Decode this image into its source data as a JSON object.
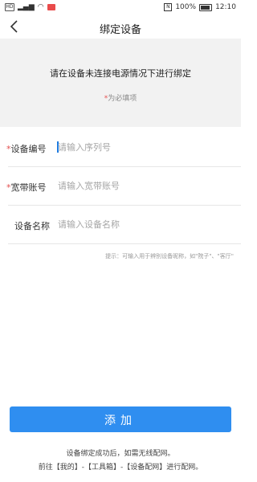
{
  "status_bar": {
    "battery_text": "100%",
    "time": "12:10",
    "nfc_label": "N"
  },
  "header": {
    "title": "绑定设备"
  },
  "banner": {
    "notice": "请在设备未连接电源情况下进行绑定",
    "required_star": "*",
    "required_text": "为必填项"
  },
  "form": {
    "device_id": {
      "star": "*",
      "label": "设备编号",
      "placeholder": "请输入序列号",
      "value": ""
    },
    "broadband": {
      "star": "*",
      "label": "宽带账号",
      "placeholder": "请输入宽带账号",
      "value": ""
    },
    "device_name": {
      "label": "设备名称",
      "placeholder": "请输入设备名称",
      "value": ""
    },
    "hint": "提示：可输入用于辨别设备昵称，如\"院子\"、\"客厅\""
  },
  "add_button": {
    "label": "添加"
  },
  "footer": {
    "line1": "设备绑定成功后，如需无线配网。",
    "line2": "前往【我的】-【工具箱】-【设备配网】进行配网。"
  },
  "colors": {
    "accent": "#2f8ef0",
    "required": "#e45050",
    "banner_bg": "#f2f2f2"
  }
}
